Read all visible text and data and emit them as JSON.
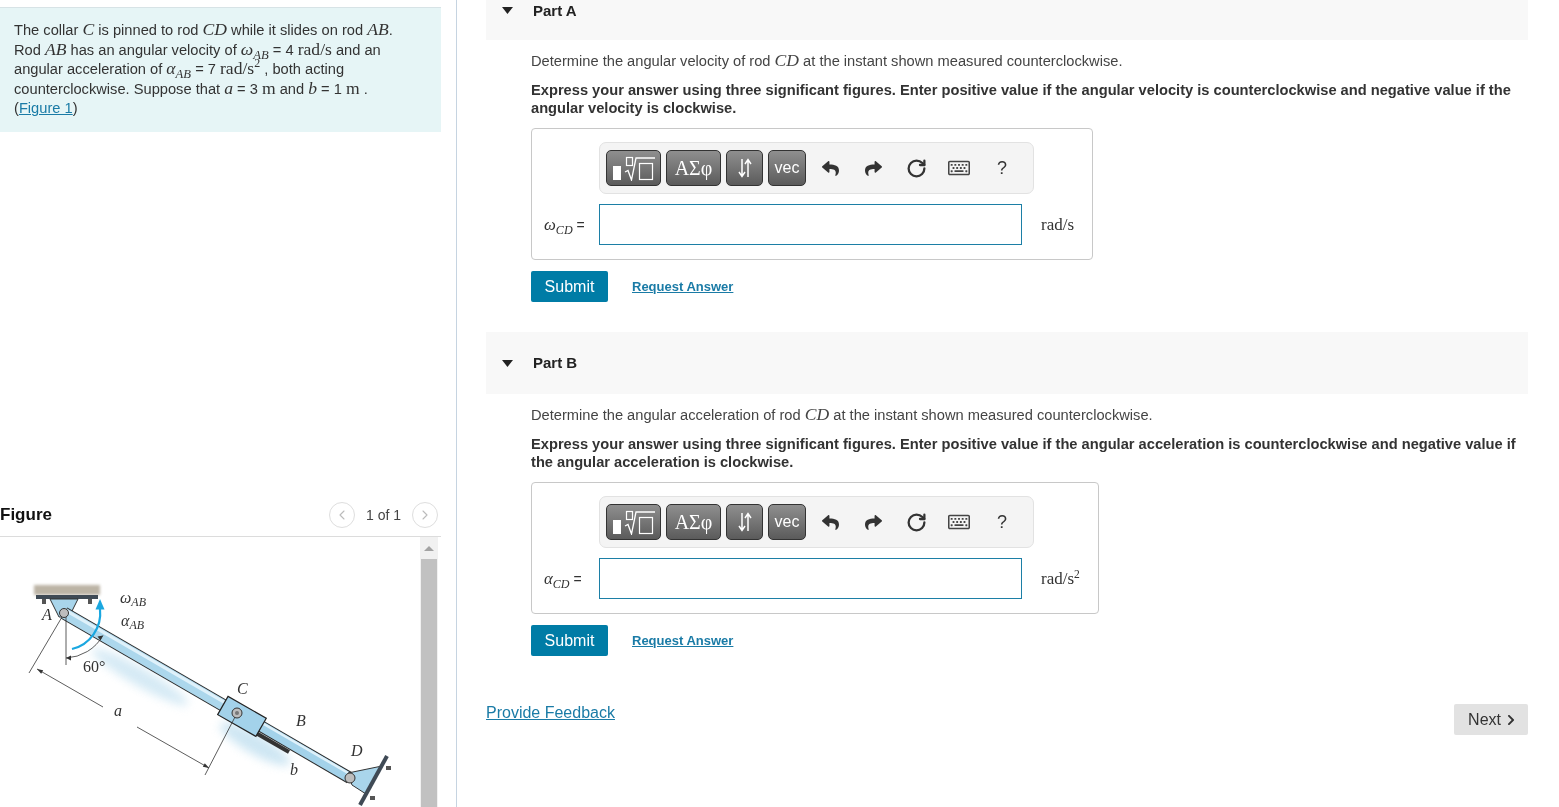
{
  "problem": {
    "segments": [
      {
        "kind": "text",
        "text": "The collar "
      },
      {
        "kind": "math",
        "text": "*C*"
      },
      {
        "kind": "text",
        "text": " is pinned to rod "
      },
      {
        "kind": "math",
        "text": "*CD*"
      },
      {
        "kind": "text",
        "text": " while it slides on rod "
      },
      {
        "kind": "math",
        "text": "*AB*"
      },
      {
        "kind": "text",
        "text": ". Rod "
      },
      {
        "kind": "math",
        "text": "*AB*"
      },
      {
        "kind": "text",
        "text": " has an angular velocity of "
      },
      {
        "kind": "math",
        "text": "*ω*$_{AB}$"
      },
      {
        "kind": "text",
        "text": " = 4 "
      },
      {
        "kind": "math",
        "text": "rad/s"
      },
      {
        "kind": "text",
        "text": " and an angular acceleration of "
      },
      {
        "kind": "math",
        "text": "*α*$_{AB}$"
      },
      {
        "kind": "text",
        "text": " = 7 "
      },
      {
        "kind": "math",
        "text": "rad/s$^{2}$"
      },
      {
        "kind": "text",
        "text": " , both acting counterclockwise. Suppose that "
      },
      {
        "kind": "math",
        "text": "*a*"
      },
      {
        "kind": "text",
        "text": " = 3 "
      },
      {
        "kind": "math",
        "text": "m"
      },
      {
        "kind": "text",
        "text": " and "
      },
      {
        "kind": "math",
        "text": "*b*"
      },
      {
        "kind": "text",
        "text": " = 1 "
      },
      {
        "kind": "math",
        "text": "m"
      },
      {
        "kind": "text",
        "text": " . ("
      },
      {
        "kind": "link",
        "text": "Figure 1"
      },
      {
        "kind": "text",
        "text": ")"
      }
    ]
  },
  "figure_panel": {
    "title": "Figure",
    "pager": "1 of 1",
    "labels": [
      "*ω*$_{AB}$",
      "*α*$_{AB}$",
      "*A*",
      "60°",
      "*C*",
      "*a*",
      "*B*",
      "*D*",
      "*b*"
    ]
  },
  "parts": [
    {
      "title": "Part A",
      "expanded": true,
      "question": [
        {
          "kind": "text",
          "text": "Determine the angular velocity of rod "
        },
        {
          "kind": "math",
          "text": "*CD*"
        },
        {
          "kind": "text",
          "text": " at the instant shown measured counterclockwise."
        }
      ],
      "instruction": "Express your answer using three significant figures. Enter positive value if the angular velocity is counterclockwise and negative value if the angular velocity is clockwise.",
      "toolbar": [
        {
          "kind": "templates"
        },
        {
          "kind": "symbols",
          "label": "ΑΣφ"
        },
        {
          "kind": "arrows"
        },
        {
          "kind": "vector",
          "label": "vec"
        },
        {
          "kind": "undo"
        },
        {
          "kind": "redo"
        },
        {
          "kind": "reset"
        },
        {
          "kind": "keyboard"
        },
        {
          "kind": "help",
          "label": "?"
        }
      ],
      "answer_label": [
        {
          "kind": "math",
          "text": "*ω*$_{CD}$"
        },
        {
          "kind": "text",
          "text": " ="
        }
      ],
      "unit": "rad/s",
      "submit": "Submit",
      "request": "Request Answer"
    },
    {
      "title": "Part B",
      "expanded": true,
      "question": [
        {
          "kind": "text",
          "text": "Determine the angular acceleration of rod "
        },
        {
          "kind": "math",
          "text": "*CD*"
        },
        {
          "kind": "text",
          "text": " at the instant shown measured counterclockwise."
        }
      ],
      "instruction": "Express your answer using three significant figures. Enter positive value if the angular acceleration is counterclockwise and negative value if the angular acceleration is clockwise.",
      "toolbar": [
        {
          "kind": "templates"
        },
        {
          "kind": "symbols",
          "label": "ΑΣφ"
        },
        {
          "kind": "arrows"
        },
        {
          "kind": "vector",
          "label": "vec"
        },
        {
          "kind": "undo"
        },
        {
          "kind": "redo"
        },
        {
          "kind": "reset"
        },
        {
          "kind": "keyboard"
        },
        {
          "kind": "help",
          "label": "?"
        }
      ],
      "answer_label": [
        {
          "kind": "math",
          "text": "*α*$_{CD}$"
        },
        {
          "kind": "text",
          "text": " ="
        }
      ],
      "unit": "rad/s$^{2}$",
      "submit": "Submit",
      "request": "Request Answer"
    }
  ],
  "footer": {
    "feedback_link": "Provide Feedback",
    "next_button": "Next"
  }
}
